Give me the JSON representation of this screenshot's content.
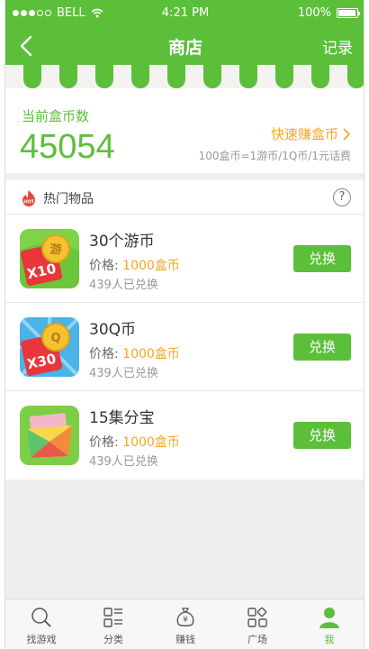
{
  "status": {
    "carrier": "BELL",
    "time": "4:21 PM",
    "battery": "100%"
  },
  "nav": {
    "title": "商店",
    "right": "记录"
  },
  "balance": {
    "label": "当前盒币数",
    "value": "45054",
    "earn": "快速赚盒币",
    "rate": "100盒币=1游币/1Q币/1元话费"
  },
  "section": {
    "title": "热门物品",
    "hot_badge": "HOT",
    "help": "?"
  },
  "items": [
    {
      "name": "30个游币",
      "price_label": "价格:",
      "price": "1000盒币",
      "exchanged": "439人已兑换",
      "button": "兑换",
      "badge": "X10",
      "coin_char": "游"
    },
    {
      "name": "30Q币",
      "price_label": "价格:",
      "price": "1000盒币",
      "exchanged": "439人已兑换",
      "button": "兑换",
      "badge": "X30",
      "coin_char": "Q"
    },
    {
      "name": "15集分宝",
      "price_label": "价格:",
      "price": "1000盒币",
      "exchanged": "439人已兑换",
      "button": "兑换"
    }
  ],
  "tabs": [
    {
      "label": "找游戏",
      "icon": "search-icon"
    },
    {
      "label": "分类",
      "icon": "category-icon"
    },
    {
      "label": "赚钱",
      "icon": "money-bag-icon"
    },
    {
      "label": "广场",
      "icon": "square-icon"
    },
    {
      "label": "我",
      "icon": "person-icon"
    }
  ],
  "colors": {
    "brand": "#5cbf3a",
    "accent": "#f5a623"
  }
}
